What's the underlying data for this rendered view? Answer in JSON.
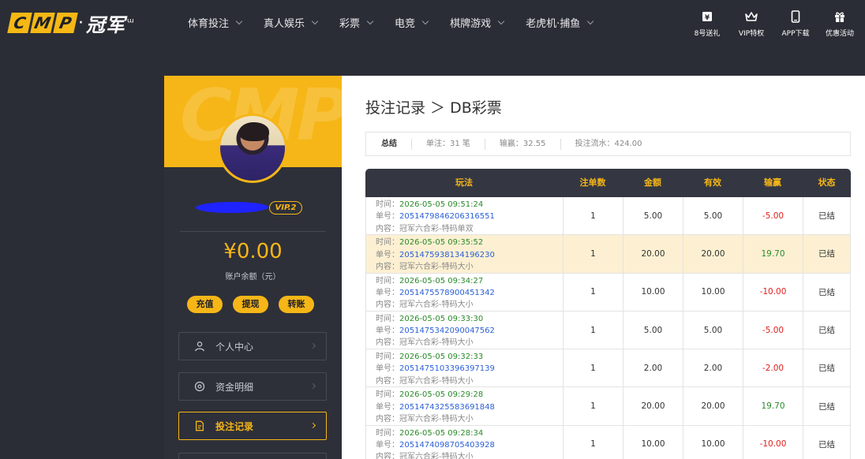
{
  "logo": {
    "letters": [
      "C",
      "M",
      "P"
    ],
    "dot": "·",
    "cn": "冠军",
    "tail": "ᵚ"
  },
  "nav": [
    {
      "label": "体育投注"
    },
    {
      "label": "真人娱乐"
    },
    {
      "label": "彩票"
    },
    {
      "label": "电竞"
    },
    {
      "label": "棋牌游戏"
    },
    {
      "label": "老虎机·捕鱼"
    }
  ],
  "top_actions": [
    {
      "label": "8号送礼",
      "icon": "ticket-icon"
    },
    {
      "label": "VIP特权",
      "icon": "crown-icon"
    },
    {
      "label": "APP下载",
      "icon": "phone-icon"
    },
    {
      "label": "优惠活动",
      "icon": "gift-icon"
    }
  ],
  "profile": {
    "watermark": "CMP",
    "vip": "VIP.2",
    "balance": "¥0.00",
    "balance_label": "账户余额（元）",
    "wallet_buttons": [
      "充值",
      "提现",
      "转账"
    ]
  },
  "menu": [
    {
      "label": "个人中心",
      "icon": "user-icon"
    },
    {
      "label": "资金明细",
      "icon": "wallet-icon"
    },
    {
      "label": "投注记录",
      "icon": "document-icon",
      "active": true
    }
  ],
  "page": {
    "title": "投注记录 ＞ DB彩票",
    "summary": {
      "head": "总结",
      "bets": "单注：31 笔",
      "winloss": "输赢：32.55",
      "turnover": "投注流水：424.00"
    }
  },
  "table": {
    "headers": [
      "玩法",
      "注单数",
      "金额",
      "有效",
      "输赢",
      "状态"
    ],
    "labels": {
      "time": "时间：",
      "order": "单号：",
      "content": "内容："
    },
    "rows": [
      {
        "time": "2026-05-05 09:51:24",
        "order": "2051479846206316551",
        "content": "冠军六合彩-特码单双",
        "count": "1",
        "amount": "5.00",
        "valid": "5.00",
        "winloss": "-5.00",
        "status": "已结"
      },
      {
        "time": "2026-05-05 09:35:52",
        "order": "2051475938134196230",
        "content": "冠军六合彩-特码大小",
        "count": "1",
        "amount": "20.00",
        "valid": "20.00",
        "winloss": "19.70",
        "status": "已结",
        "highlight": true
      },
      {
        "time": "2026-05-05 09:34:27",
        "order": "2051475578900451342",
        "content": "冠军六合彩-特码大小",
        "count": "1",
        "amount": "10.00",
        "valid": "10.00",
        "winloss": "-10.00",
        "status": "已结"
      },
      {
        "time": "2026-05-05 09:33:30",
        "order": "2051475342090047562",
        "content": "冠军六合彩-特码大小",
        "count": "1",
        "amount": "5.00",
        "valid": "5.00",
        "winloss": "-5.00",
        "status": "已结"
      },
      {
        "time": "2026-05-05 09:32:33",
        "order": "2051475103396397139",
        "content": "冠军六合彩-特码大小",
        "count": "1",
        "amount": "2.00",
        "valid": "2.00",
        "winloss": "-2.00",
        "status": "已结"
      },
      {
        "time": "2026-05-05 09:29:28",
        "order": "2051474325583691848",
        "content": "冠军六合彩-特码大小",
        "count": "1",
        "amount": "20.00",
        "valid": "20.00",
        "winloss": "19.70",
        "status": "已结"
      },
      {
        "time": "2026-05-05 09:28:34",
        "order": "2051474098705403928",
        "content": "冠军六合彩-特码大小",
        "count": "1",
        "amount": "10.00",
        "valid": "10.00",
        "winloss": "-10.00",
        "status": "已结"
      }
    ]
  },
  "colors": {
    "accent": "#f6b617",
    "bg": "#2b2d36",
    "positive": "#2a8a2a",
    "negative": "#e02020",
    "link": "#2a5fd6"
  }
}
